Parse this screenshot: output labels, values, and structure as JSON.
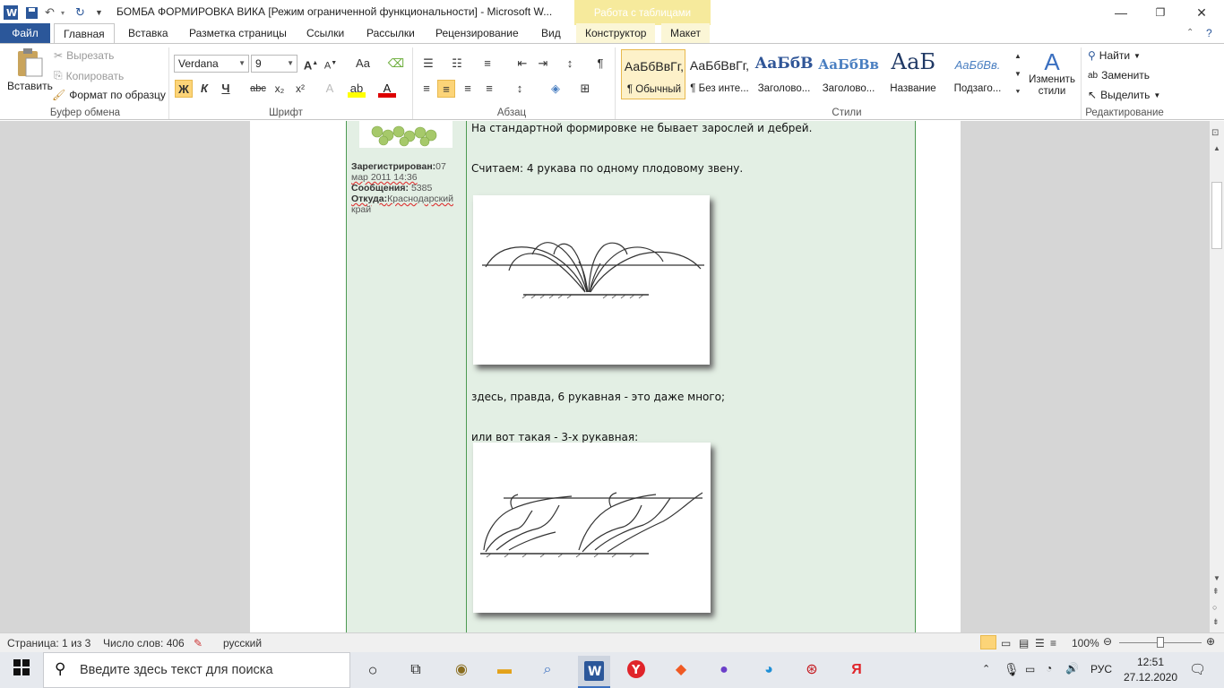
{
  "window": {
    "title": "БОМБА ФОРМИРОВКА ВИКА [Режим ограниченной функциональности]  -  Microsoft W...",
    "context_tab_group": "Работа с таблицами",
    "controls": {
      "minimize": "—",
      "restore": "❐",
      "close": "✕"
    }
  },
  "tabs": [
    "Файл",
    "Главная",
    "Вставка",
    "Разметка страницы",
    "Ссылки",
    "Рассылки",
    "Рецензирование",
    "Вид",
    "Конструктор",
    "Макет"
  ],
  "ribbon": {
    "clipboard": {
      "paste": "Вставить",
      "cut": "Вырезать",
      "copy": "Копировать",
      "format_painter": "Формат по образцу",
      "label": "Буфер обмена"
    },
    "font": {
      "name": "Verdana",
      "size": "9",
      "label": "Шрифт",
      "bold": "Ж",
      "italic": "К",
      "underline": "Ч",
      "strike": "abc",
      "sub": "x₂",
      "sup": "x²",
      "case": "Aa"
    },
    "paragraph": {
      "label": "Абзац"
    },
    "styles": {
      "label": "Стили",
      "items": [
        {
          "sample": "АаБбВвГг,",
          "name": "¶ Обычный"
        },
        {
          "sample": "АаБбВвГг,",
          "name": "¶ Без инте..."
        },
        {
          "sample": "АаБбВ",
          "name": "Заголово..."
        },
        {
          "sample": "АаБбВв",
          "name": "Заголово..."
        },
        {
          "sample": "АаБ",
          "name": "Название"
        },
        {
          "sample": "АаБбВв.",
          "name": "Подзаго..."
        }
      ],
      "change_styles": "Изменить стили"
    },
    "editing": {
      "find": "Найти",
      "replace": "Заменить",
      "select": "Выделить",
      "label": "Редактирование"
    }
  },
  "document": {
    "profile": {
      "registered_label": "Зарегистрирован:",
      "registered_value_a": "07",
      "registered_value_b": "мар 2011  14:36",
      "messages_label": "Сообщения:",
      "messages_value": "5385",
      "from_label": "Откуда:",
      "from_value_a": "Краснодарский",
      "from_value_b": "край"
    },
    "lines": [
      "На стандартной формировке не бывает зарослей и дебрей.",
      "Считаем:  4 рукава по одному плодовому звену.",
      "здесь, правда,  6 рукавная  - это даже много;",
      "или вот такая  - 3-х рукавная:"
    ]
  },
  "status": {
    "page": "Страница: 1 из 3",
    "words": "Число слов: 406",
    "language": "русский",
    "zoom": "100%"
  },
  "taskbar": {
    "search_placeholder": "Введите здесь текст для поиска",
    "lang": "РУС",
    "time": "12:51",
    "date": "27.12.2020"
  }
}
